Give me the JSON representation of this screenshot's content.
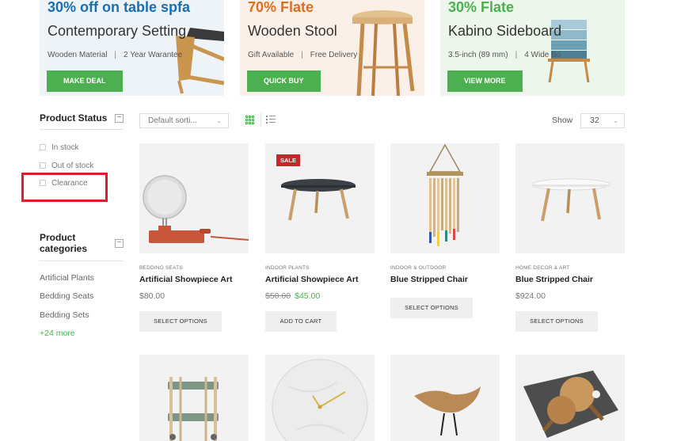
{
  "banners": [
    {
      "discount": "30% off on table spfa",
      "title": "Contemporary Setting",
      "meta1": "Wooden Material",
      "meta2": "2 Year Warantee",
      "button": "MAKE DEAL"
    },
    {
      "discount": "70% Flate",
      "title": "Wooden Stool",
      "meta1": "Gift Available",
      "meta2": "Free Delivery",
      "button": "QUICK BUY"
    },
    {
      "discount": "30% Flate",
      "title": "Kabino Sideboard",
      "meta1": "3.5-inch (89 mm)",
      "meta2": "4 Wide Bo",
      "button": "VIEW MORE"
    }
  ],
  "sidebar": {
    "status_heading": "Product Status",
    "status_toggle": "−",
    "status_items": [
      "In stock",
      "Out of stock",
      "Clearance"
    ],
    "categories_heading_line1": "Product",
    "categories_heading_line2": "categories",
    "categories_toggle": "−",
    "categories": [
      "Artificial Plants",
      "Bedding Seats",
      "Bedding Sets"
    ],
    "more_link": "+24 more"
  },
  "toolbar": {
    "sort_value": "Default sorti...",
    "show_label": "Show",
    "show_value": "32"
  },
  "products": [
    {
      "category": "BEDDING SEATS",
      "name": "Artificial Showpiece Art",
      "price": "$80.00",
      "button": "SELECT OPTIONS"
    },
    {
      "category": "INDOOR PLANTS",
      "name": "Artificial Showpiece Art",
      "old_price": "$50.00",
      "new_price": "$45.00",
      "badge": "SALE",
      "button": "ADD TO CART"
    },
    {
      "category": "INDOOR & OUTDOOR",
      "name": "Blue Stripped Chair",
      "button": "SELECT OPTIONS"
    },
    {
      "category": "HOME DECOR & ART",
      "name": "Blue Stripped Chair",
      "price": "$924.00",
      "button": "SELECT OPTIONS"
    }
  ],
  "icons": {
    "grid_view": "grid-view-icon",
    "list_view": "list-view-icon",
    "dropdown": "chevron-down-icon"
  },
  "colors": {
    "accent": "#4caf50",
    "sale": "#c9262c",
    "highlight": "#e01e2a",
    "banner1_discount": "#1a6fb3",
    "banner2_discount": "#e06c1f"
  }
}
